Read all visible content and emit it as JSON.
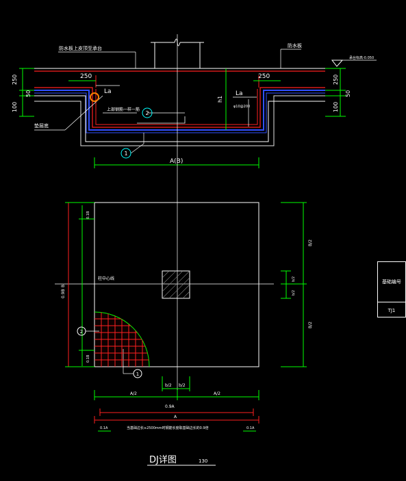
{
  "drawing": {
    "title": "DJ详图",
    "scale": "130",
    "section": {
      "label_top_left": "防水板上皮顶至承台",
      "label_top_right": "防水板",
      "label_elev": "承台标高-0.050",
      "label_cushion": "垫层底",
      "label_rebar": "上部钢筋一样一筋",
      "dim_250_left": "250",
      "dim_250_right": "250",
      "dim_250_v_left": "250",
      "dim_50_left": "50",
      "dim_100_left": "100",
      "dim_250_v_right": "250",
      "dim_50_right": "50",
      "dim_100_right": "100",
      "dim_la_left": "La",
      "dim_la_right": "La",
      "dim_h1": "h1",
      "dim_spacing": "φ10@200",
      "dim_width": "A(B)",
      "marker_1": "1",
      "marker_2": "2"
    },
    "plan": {
      "label_center": "柱中心线",
      "dim_b_total": "B",
      "dim_b_ratio": "0.9B",
      "dim_b_half_top": "B/2",
      "dim_b_half_bot": "B/2",
      "dim_b2_top": "b/2",
      "dim_b2_bot": "b/2",
      "dim_a_half_left": "A/2",
      "dim_a_half_right": "A/2",
      "dim_b2_left": "b/2",
      "dim_b2_right": "b/2",
      "dim_09a": "0.9A",
      "dim_a": "A",
      "dim_01a_left": "0.1A",
      "dim_01a_right": "0.1A",
      "dim_small_top": "0.1B",
      "dim_small_bot": "0.1B",
      "note": "当基础边长≥2500mm时钢筋长度取基础边长的0.9倍",
      "marker_1": "1",
      "marker_2": "2"
    },
    "table": {
      "header": "基础编号",
      "value": "TJ1"
    }
  },
  "colors": {
    "background": "#000000",
    "line_white": "#ffffff",
    "dim_green": "#00ff00",
    "rebar_red": "#ff2020",
    "rebar_blue": "#3050ff",
    "marker_cyan": "#00ffff",
    "highlight_orange": "#ff7f00"
  }
}
